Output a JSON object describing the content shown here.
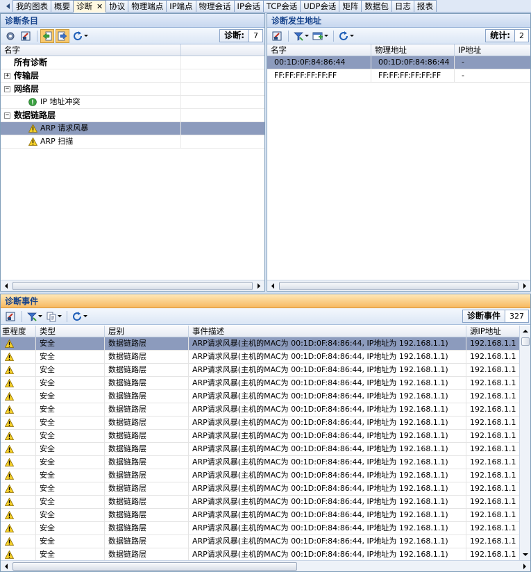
{
  "tabs": [
    {
      "label": "我的图表",
      "active": false
    },
    {
      "label": "概要",
      "active": false
    },
    {
      "label": "诊断",
      "active": true
    },
    {
      "label": "协议",
      "active": false
    },
    {
      "label": "物理端点",
      "active": false
    },
    {
      "label": "IP端点",
      "active": false
    },
    {
      "label": "物理会话",
      "active": false
    },
    {
      "label": "IP会话",
      "active": false
    },
    {
      "label": "TCP会话",
      "active": false
    },
    {
      "label": "UDP会话",
      "active": false
    },
    {
      "label": "矩阵",
      "active": false
    },
    {
      "label": "数据包",
      "active": false
    },
    {
      "label": "日志",
      "active": false
    },
    {
      "label": "报表",
      "active": false
    }
  ],
  "tab_close_glyph": "✕",
  "diag_items": {
    "title": "诊断条目",
    "counter_label": "诊断:",
    "counter_value": "7",
    "column_name": "名字",
    "tree": [
      {
        "label": "所有诊断",
        "level": 0,
        "bold": true,
        "toggle": "",
        "icon": ""
      },
      {
        "label": "传输层",
        "level": 0,
        "bold": true,
        "toggle": "+",
        "icon": ""
      },
      {
        "label": "网络层",
        "level": 0,
        "bold": true,
        "toggle": "−",
        "icon": ""
      },
      {
        "label": "IP 地址冲突",
        "level": 1,
        "bold": false,
        "toggle": "",
        "icon": "info"
      },
      {
        "label": "数据链路层",
        "level": 0,
        "bold": true,
        "toggle": "−",
        "icon": ""
      },
      {
        "label": "ARP 请求风暴",
        "level": 1,
        "bold": false,
        "toggle": "",
        "icon": "warn",
        "selected": true
      },
      {
        "label": "ARP 扫描",
        "level": 1,
        "bold": false,
        "toggle": "",
        "icon": "warn"
      }
    ]
  },
  "diag_addr": {
    "title": "诊断发生地址",
    "counter_label": "统计:",
    "counter_value": "2",
    "columns": [
      "名字",
      "物理地址",
      "IP地址"
    ],
    "rows": [
      {
        "name": "00:1D:0F:84:86:44",
        "mac": "00:1D:0F:84:86:44",
        "ip": "-",
        "selected": true
      },
      {
        "name": "FF:FF:FF:FF:FF:FF",
        "mac": "FF:FF:FF:FF:FF:FF",
        "ip": "-",
        "selected": false
      }
    ]
  },
  "events": {
    "title": "诊断事件",
    "counter_label": "诊断事件",
    "counter_value": "327",
    "columns": [
      "重程度",
      "类型",
      "层别",
      "事件描述",
      "源IP地址"
    ],
    "row_type": "安全",
    "row_layer": "数据链路层",
    "row_desc": "ARP请求风暴(主机的MAC为 00:1D:0F:84:86:44, IP地址为 192.168.1.1)",
    "row_src_ip": "192.168.1.1",
    "visible_rows": 17
  },
  "colors": {
    "accent_title": "#15428b",
    "selected_row": "#8c9bbd",
    "events_title_bg": "#f7b960"
  }
}
